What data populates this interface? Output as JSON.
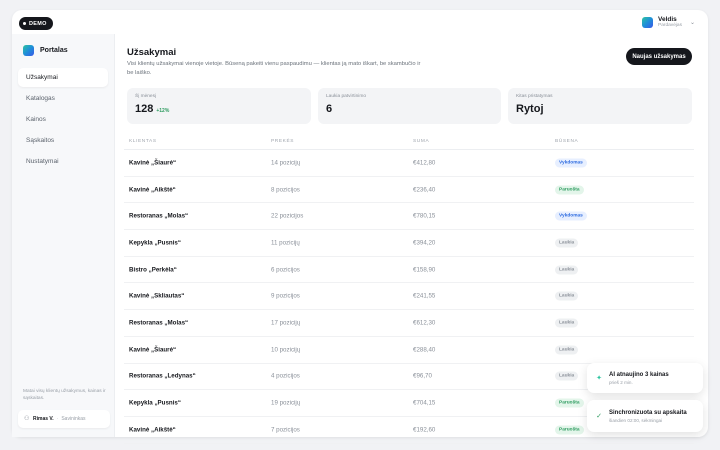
{
  "demo_badge": "DEMO",
  "user_menu": {
    "name": "Veldis",
    "role": "Pardavėjas"
  },
  "sidebar": {
    "brand": "Portalas",
    "items": [
      {
        "label": "Užsakymai",
        "active": true
      },
      {
        "label": "Katalogas",
        "active": false
      },
      {
        "label": "Kainos",
        "active": false
      },
      {
        "label": "Sąskaitos",
        "active": false
      },
      {
        "label": "Nustatymai",
        "active": false
      }
    ],
    "footer_text": "Matai visų klientų užsakymus, kainas ir sąskaitas.",
    "profile": {
      "name": "Rimas V.",
      "separator": "·",
      "role": "Savininkas"
    }
  },
  "main": {
    "title": "Užsakymai",
    "subtitle": "Visi klientų užsakymai vienoje vietoje. Būseną pakeiti vienu paspaudimu — klientas ją mato iškart, be skambučio ir be laiško.",
    "new_order_button": "Naujas užsakymas"
  },
  "stats": [
    {
      "label": "Šį mėnesį",
      "value": "128",
      "delta": "+12%"
    },
    {
      "label": "Laukia patvirtinimo",
      "value": "6",
      "delta": ""
    },
    {
      "label": "Kitas pristatymas",
      "value": "Rytoj",
      "delta": ""
    }
  ],
  "table": {
    "columns": [
      "KLIENTAS",
      "PREKĖS",
      "SUMA",
      "BŪSENA"
    ],
    "rows": [
      {
        "client": "Kavinė „Šiaurė“",
        "items": "14 pozicijų",
        "sum": "€412,80",
        "status": "Vykdomas",
        "status_type": "vykdomas"
      },
      {
        "client": "Kavinė „Aikštė“",
        "items": "8 pozicijos",
        "sum": "€236,40",
        "status": "Paruošta",
        "status_type": "paruosta"
      },
      {
        "client": "Restoranas „Molas“",
        "items": "22 pozicijos",
        "sum": "€780,15",
        "status": "Vykdomas",
        "status_type": "vykdomas"
      },
      {
        "client": "Kepykla „Pusnis“",
        "items": "11 pozicijų",
        "sum": "€394,20",
        "status": "Laukia",
        "status_type": "laukia"
      },
      {
        "client": "Bistro „Perkėla“",
        "items": "6 pozicijos",
        "sum": "€158,90",
        "status": "Laukia",
        "status_type": "laukia"
      },
      {
        "client": "Kavinė „Skliautas“",
        "items": "9 pozicijos",
        "sum": "€241,55",
        "status": "Laukia",
        "status_type": "laukia"
      },
      {
        "client": "Restoranas „Molas“",
        "items": "17 pozicijų",
        "sum": "€612,30",
        "status": "Laukia",
        "status_type": "laukia"
      },
      {
        "client": "Kavinė „Šiaurė“",
        "items": "10 pozicijų",
        "sum": "€288,40",
        "status": "Laukia",
        "status_type": "laukia"
      },
      {
        "client": "Restoranas „Ledynas“",
        "items": "4 pozicijos",
        "sum": "€96,70",
        "status": "Laukia",
        "status_type": "laukia"
      },
      {
        "client": "Kepykla „Pusnis“",
        "items": "19 pozicijų",
        "sum": "€704,15",
        "status": "Paruošta",
        "status_type": "paruosta"
      },
      {
        "client": "Kavinė „Aikštė“",
        "items": "7 pozicijos",
        "sum": "€192,60",
        "status": "Paruošta",
        "status_type": "paruosta"
      }
    ]
  },
  "toasts": [
    {
      "icon": "sparkle-icon",
      "title": "AI atnaujino 3 kainas",
      "subtitle": "prieš 2 min."
    },
    {
      "icon": "check-icon",
      "title": "Sinchronizuota su apskaita",
      "subtitle": "šiandien 02:00, sėkmingai"
    }
  ],
  "colors": {
    "primary": "#15171c",
    "brand_gradient": [
      "#2ec4a0",
      "#1e8fd8",
      "#3a57e8"
    ],
    "status_vykdomas": "#2d6be0",
    "status_paruosta": "#2d9b5f",
    "status_laukia": "#8a9099"
  }
}
